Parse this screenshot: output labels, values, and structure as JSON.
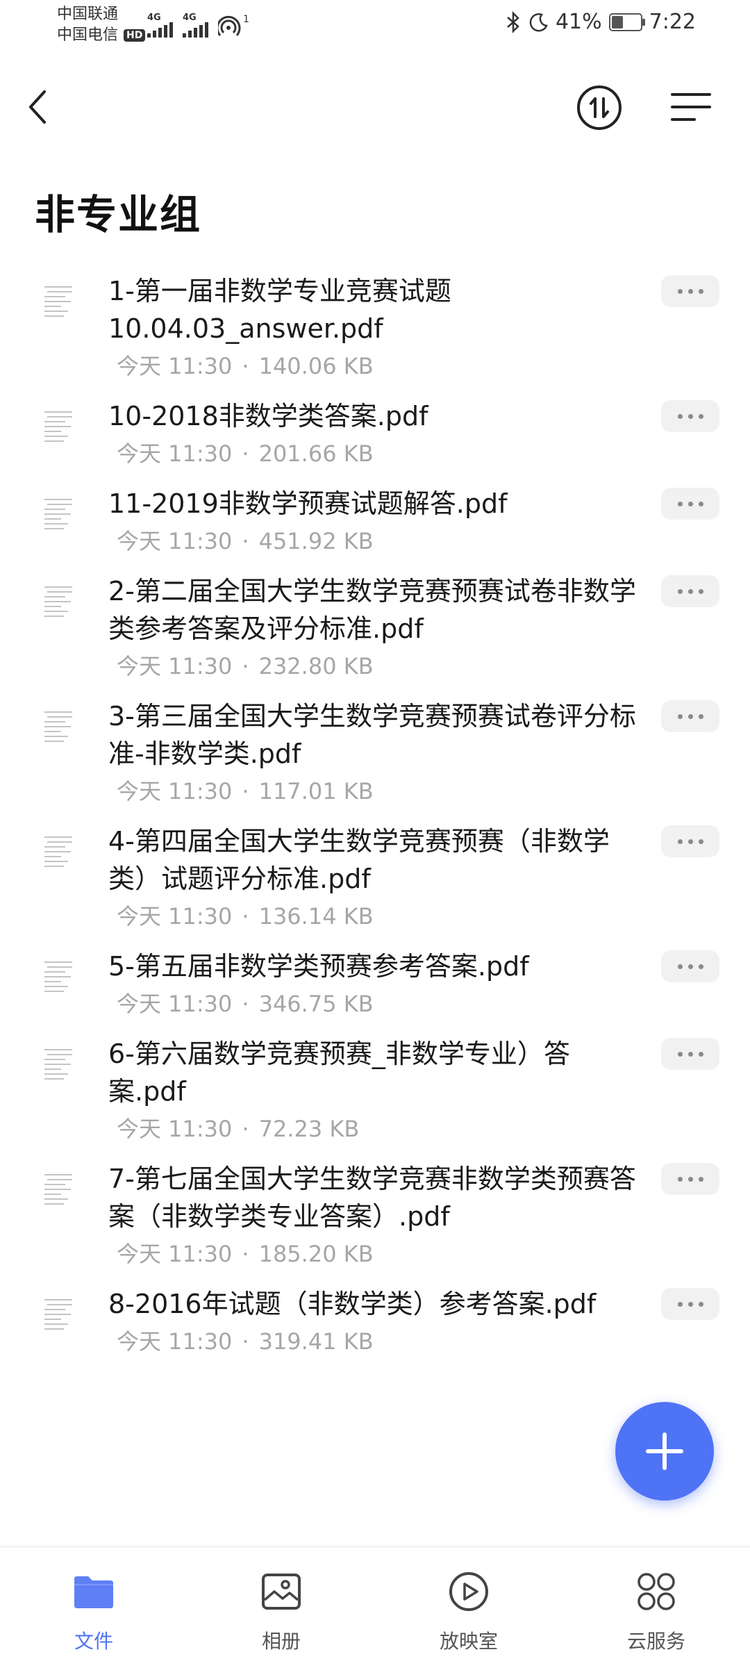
{
  "status_bar": {
    "carrier_1": "中国联通",
    "carrier_2": "中国电信",
    "hd_badge": "HD",
    "net_1": "4G",
    "net_2": "4G",
    "hotspot_count": "1",
    "battery_percent": "41%",
    "battery_level": 0.41,
    "time": "7:22"
  },
  "header": {
    "title": "非专业组"
  },
  "files": [
    {
      "name": "1-第一届非数学专业竞赛试题10.04.03_answer.pdf",
      "time": "今天 11:30",
      "size": "140.06 KB"
    },
    {
      "name": "10-2018非数学类答案.pdf",
      "time": "今天 11:30",
      "size": "201.66 KB"
    },
    {
      "name": "11-2019非数学预赛试题解答.pdf",
      "time": "今天 11:30",
      "size": "451.92 KB"
    },
    {
      "name": "2-第二届全国大学生数学竞赛预赛试卷非数学类参考答案及评分标准.pdf",
      "time": "今天 11:30",
      "size": "232.80 KB"
    },
    {
      "name": "3-第三届全国大学生数学竞赛预赛试卷评分标准-非数学类.pdf",
      "time": "今天 11:30",
      "size": "117.01 KB"
    },
    {
      "name": "4-第四届全国大学生数学竞赛预赛（非数学类）试题评分标准.pdf",
      "time": "今天 11:30",
      "size": "136.14 KB"
    },
    {
      "name": "5-第五届非数学类预赛参考答案.pdf",
      "time": "今天 11:30",
      "size": "346.75 KB"
    },
    {
      "name": "6-第六届数学竞赛预赛_非数学专业）答案.pdf",
      "time": "今天 11:30",
      "size": "72.23 KB"
    },
    {
      "name": "7-第七届全国大学生数学竞赛非数学类预赛答案（非数学类专业答案）.pdf",
      "time": "今天 11:30",
      "size": "185.20 KB"
    },
    {
      "name": "8-2016年试题（非数学类）参考答案.pdf",
      "time": "今天 11:30",
      "size": "319.41 KB"
    }
  ],
  "bottom_nav": {
    "tabs": [
      {
        "label": "文件",
        "icon": "folder-icon",
        "active": true
      },
      {
        "label": "相册",
        "icon": "album-icon",
        "active": false
      },
      {
        "label": "放映室",
        "icon": "play-icon",
        "active": false
      },
      {
        "label": "云服务",
        "icon": "grid-icon",
        "active": false
      }
    ]
  },
  "colors": {
    "accent": "#4f73f5",
    "meta_text": "#a6a6a6",
    "title_text": "#111111"
  }
}
